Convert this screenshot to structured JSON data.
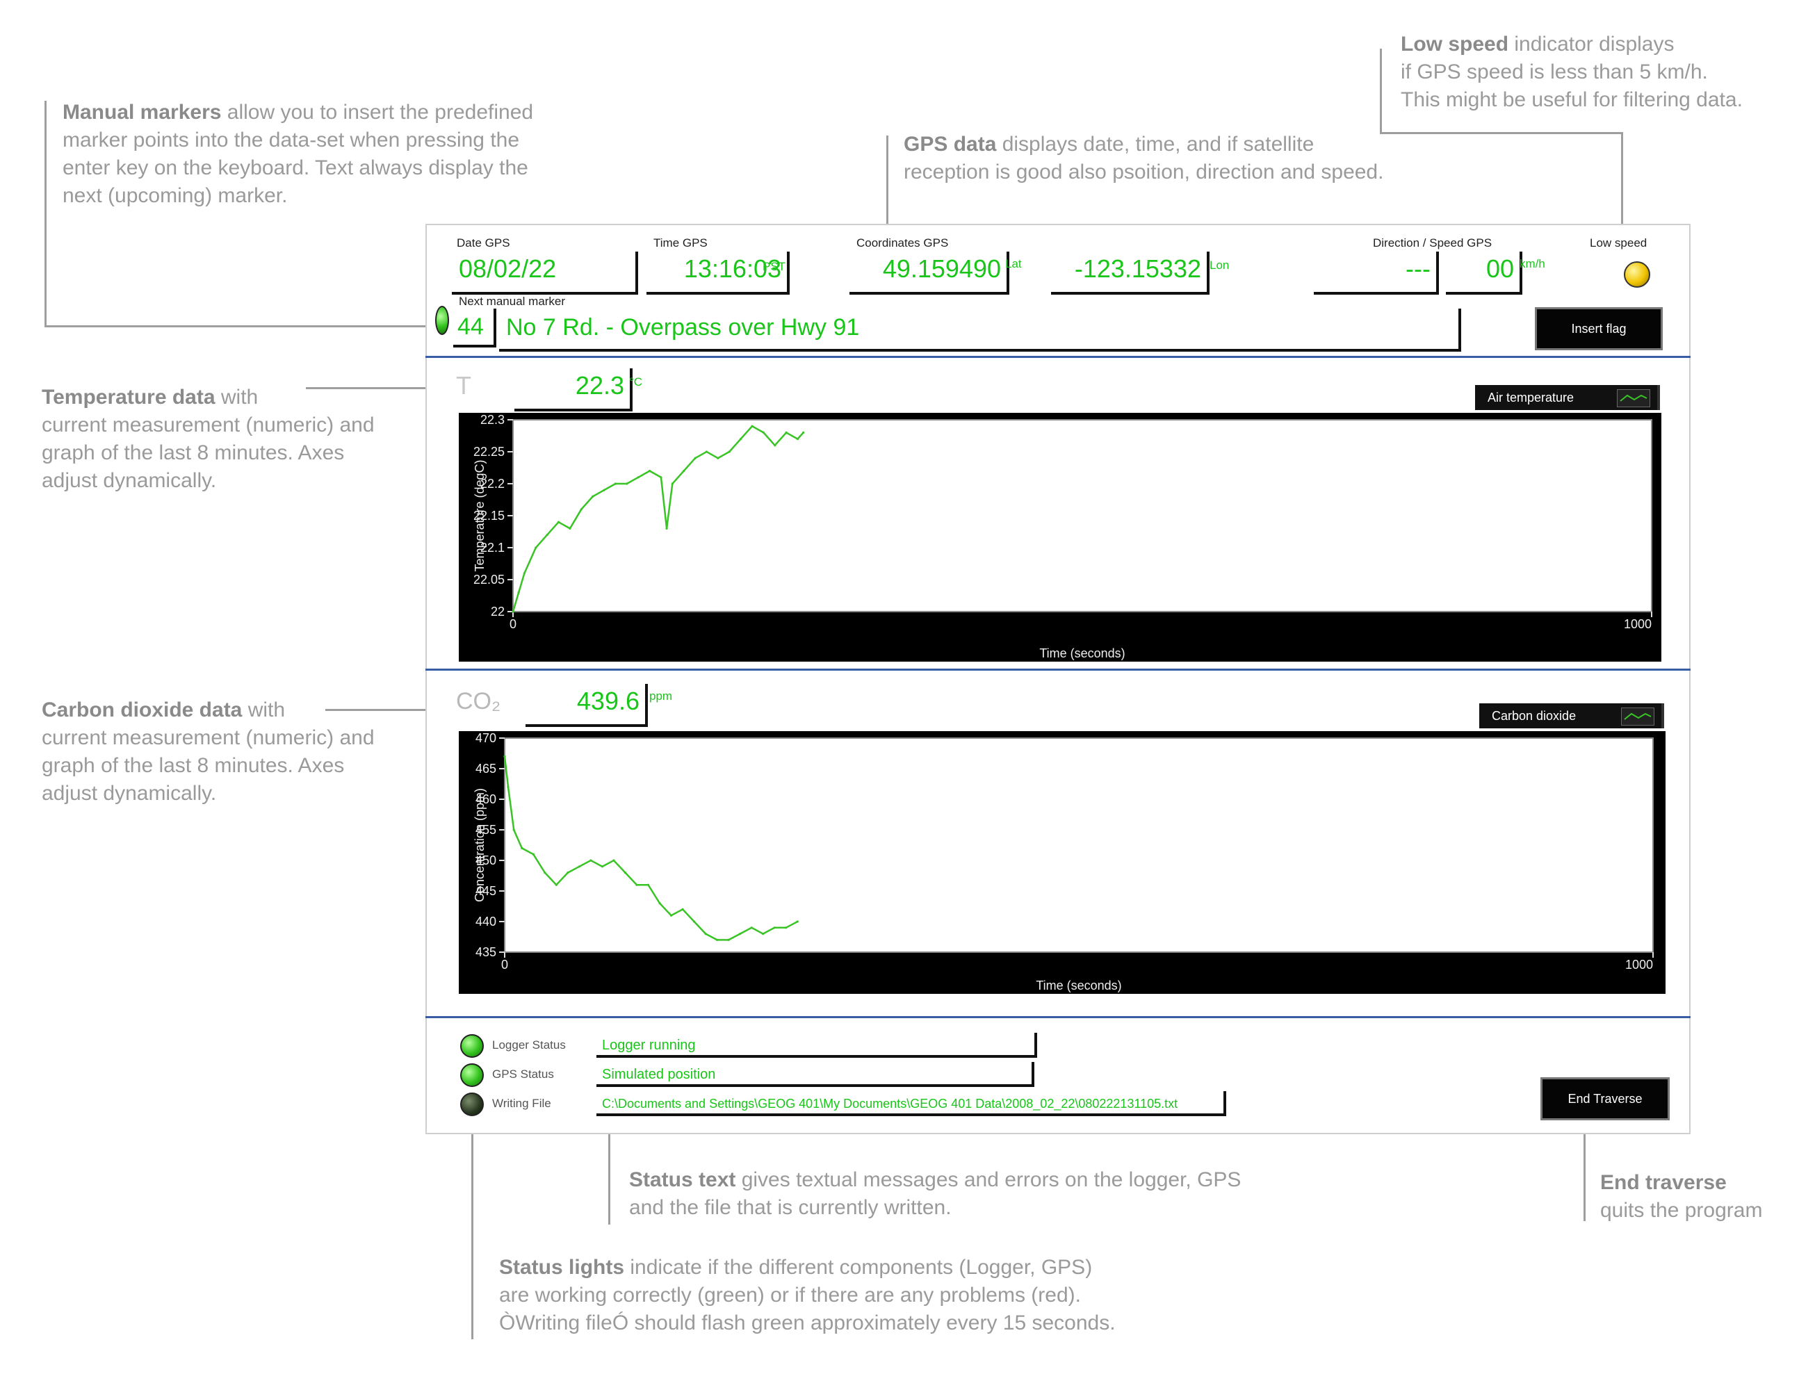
{
  "annotations": {
    "manual_markers": {
      "bold": "Manual markers",
      "rest": " allow you to insert the predefined",
      "lines": [
        "marker points into the data-set when pressing the",
        "enter key on the keyboard. Text always display the",
        "next (upcoming) marker."
      ]
    },
    "gps": {
      "bold": "GPS data",
      "rest": " displays date, time, and if satellite",
      "lines": [
        "reception is good also psoition, direction and speed."
      ]
    },
    "low_speed": {
      "bold": "Low speed",
      "rest": " indicator displays",
      "lines": [
        "if GPS speed is less than 5 km/h.",
        "This might be useful for filtering data."
      ]
    },
    "temperature": {
      "bold": "Temperature data",
      "rest": " with",
      "lines": [
        "current measurement (numeric) and",
        "graph of the last 8 minutes. Axes",
        "adjust dynamically."
      ]
    },
    "co2": {
      "bold": "Carbon dioxide data",
      "rest": " with",
      "lines": [
        "current measurement (numeric) and",
        "graph of the last 8 minutes. Axes",
        "adjust dynamically."
      ]
    },
    "status_text": {
      "bold": "Status text",
      "rest": " gives textual messages and errors on the logger, GPS",
      "lines": [
        "and the file that is currently written."
      ]
    },
    "status_lights": {
      "bold": "Status lights",
      "rest": " indicate if the different components (Logger, GPS)",
      "lines": [
        "are working correctly (green) or if there are any problems (red).",
        "ÒWriting fileÓ should flash green approximately every 15 seconds."
      ]
    },
    "end_traverse": {
      "bold": "End traverse",
      "rest": "",
      "lines": [
        "quits the program"
      ]
    }
  },
  "gps": {
    "date_label": "Date GPS",
    "date": "08/02/22",
    "time_label": "Time GPS",
    "time": "13:16:03",
    "time_unit": "PST",
    "coord_label": "Coordinates GPS",
    "lat": "49.159490",
    "lat_unit": "Lat",
    "lon": "-123.15332",
    "lon_unit": "Lon",
    "dirspeed_label": "Direction / Speed GPS",
    "direction": "---",
    "speed": "00",
    "speed_unit": "km/h",
    "low_speed_label": "Low speed"
  },
  "marker": {
    "label": "Next manual marker",
    "number": "44",
    "text": "No 7 Rd. - Overpass over Hwy 91",
    "insert_button": "Insert flag"
  },
  "temperature": {
    "label": "T",
    "value": "22.3",
    "unit": "°C",
    "legend": "Air temperature"
  },
  "co2": {
    "label": "CO₂",
    "value": "439.6",
    "unit": "ppm",
    "legend": "Carbon dioxide"
  },
  "status": {
    "logger_label": "Logger Status",
    "logger_text": "Logger running",
    "gps_label": "GPS Status",
    "gps_text": "Simulated position",
    "file_label": "Writing File",
    "file_text": "C:\\Documents and Settings\\GEOG 401\\My Documents\\GEOG 401 Data\\2008_02_22\\080222131105.txt",
    "end_button": "End Traverse"
  },
  "colors": {
    "accent_green": "#19c519",
    "separator_blue": "#3a5ea6",
    "chart_bg": "#000000",
    "led_green": "#33c31e",
    "led_yellow": "#f0c400"
  },
  "chart_data": [
    {
      "type": "line",
      "title": "",
      "xlabel": "Time (seconds)",
      "ylabel": "Temperature (degC)",
      "xlim": [
        0,
        1000
      ],
      "ylim": [
        22,
        22.3
      ],
      "x_ticks": [
        "0",
        "1000"
      ],
      "y_ticks": [
        "22",
        "22.05",
        "22.1",
        "22.15",
        "22.2",
        "22.25",
        "22.3"
      ],
      "grid": false,
      "legend": "top-right",
      "series": [
        {
          "name": "Air temperature",
          "color": "#39c425",
          "x": [
            0,
            5,
            10,
            20,
            30,
            40,
            50,
            60,
            70,
            80,
            90,
            100,
            110,
            120,
            130,
            135,
            140,
            150,
            160,
            170,
            180,
            190,
            200,
            210,
            220,
            230,
            240,
            250,
            255
          ],
          "values": [
            22.0,
            22.03,
            22.06,
            22.1,
            22.12,
            22.14,
            22.13,
            22.16,
            22.18,
            22.19,
            22.2,
            22.2,
            22.21,
            22.22,
            22.21,
            22.13,
            22.2,
            22.22,
            22.24,
            22.25,
            22.24,
            22.25,
            22.27,
            22.29,
            22.28,
            22.26,
            22.28,
            22.27,
            22.28
          ]
        }
      ]
    },
    {
      "type": "line",
      "title": "",
      "xlabel": "Time (seconds)",
      "ylabel": "Concentration (ppm)",
      "xlim": [
        0,
        1000
      ],
      "ylim": [
        435,
        470
      ],
      "x_ticks": [
        "0",
        "1000"
      ],
      "y_ticks": [
        "435",
        "440",
        "445",
        "450",
        "455",
        "460",
        "465",
        "470"
      ],
      "grid": false,
      "legend": "top-right",
      "series": [
        {
          "name": "Carbon dioxide",
          "color": "#39c425",
          "x": [
            0,
            3,
            8,
            15,
            25,
            35,
            45,
            55,
            65,
            75,
            85,
            95,
            105,
            115,
            125,
            135,
            145,
            155,
            165,
            175,
            185,
            195,
            205,
            215,
            225,
            235,
            245,
            255
          ],
          "values": [
            467,
            462,
            455,
            452,
            451,
            448,
            446,
            448,
            449,
            450,
            449,
            450,
            448,
            446,
            446,
            443,
            441,
            442,
            440,
            438,
            437,
            437,
            438,
            439,
            438,
            439,
            439,
            440
          ]
        }
      ]
    }
  ]
}
